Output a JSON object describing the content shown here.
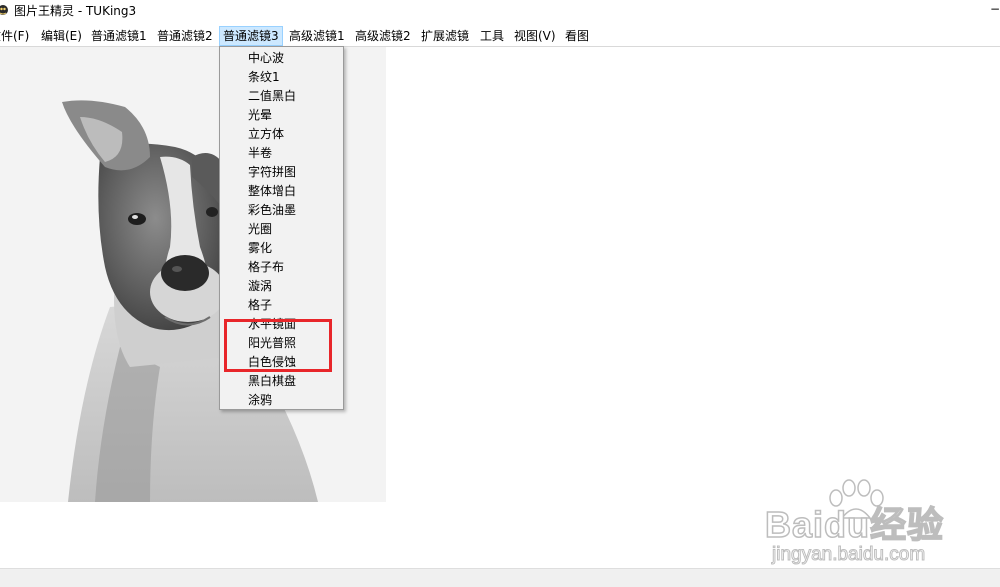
{
  "window": {
    "title": "图片王精灵 - TUKing3",
    "minimize_glyph": "−",
    "icon": "app-icon"
  },
  "menubar": {
    "items": [
      {
        "label": "文件(F)"
      },
      {
        "label": "编辑(E)"
      },
      {
        "label": "普通滤镜1"
      },
      {
        "label": "普通滤镜2"
      },
      {
        "label": "普通滤镜3",
        "active": true
      },
      {
        "label": "高级滤镜1"
      },
      {
        "label": "高级滤镜2"
      },
      {
        "label": "扩展滤镜"
      },
      {
        "label": "工具"
      },
      {
        "label": "视图(V)"
      },
      {
        "label": "看图"
      }
    ]
  },
  "dropdown": {
    "items": [
      {
        "label": "中心波"
      },
      {
        "label": "条纹1"
      },
      {
        "label": "二值黑白"
      },
      {
        "label": "光晕"
      },
      {
        "label": "立方体"
      },
      {
        "label": "半卷"
      },
      {
        "label": "字符拼图"
      },
      {
        "label": "整体增白"
      },
      {
        "label": "彩色油墨"
      },
      {
        "label": "光圈"
      },
      {
        "label": "雾化"
      },
      {
        "label": "格子布"
      },
      {
        "label": "漩涡"
      },
      {
        "label": "格子"
      },
      {
        "label": "水平镜面"
      },
      {
        "label": "阳光普照"
      },
      {
        "label": "白色侵蚀"
      },
      {
        "label": "黑白棋盘"
      },
      {
        "label": "涂鸦"
      }
    ]
  },
  "annotation": {
    "color": "#e8262a"
  },
  "watermark": {
    "brand": "Baidu经验",
    "url": "jingyan.baidu.com"
  },
  "colors": {
    "menu_active_bg": "#cce8ff",
    "menu_active_border": "#99d1ff",
    "dropdown_bg": "#f2f2f2"
  }
}
